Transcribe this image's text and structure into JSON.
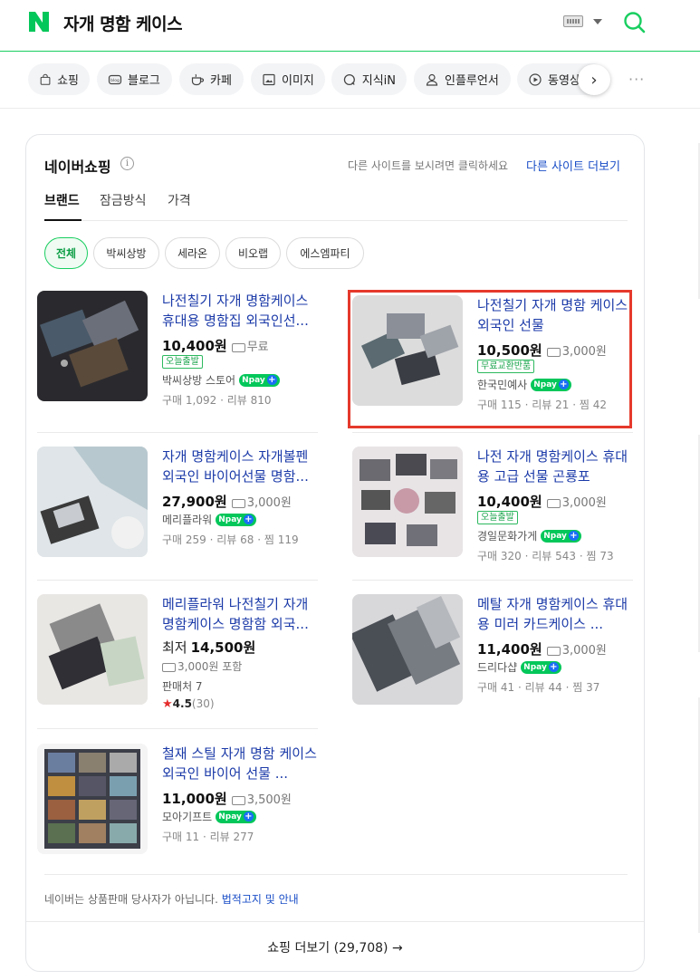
{
  "header": {
    "query": "자개 명함 케이스",
    "logo": "N"
  },
  "tabs": [
    {
      "label": "쇼핑",
      "icon": "shopping-bag-icon"
    },
    {
      "label": "블로그",
      "icon": "blog-icon"
    },
    {
      "label": "카페",
      "icon": "cafe-icon"
    },
    {
      "label": "이미지",
      "icon": "image-icon"
    },
    {
      "label": "지식iN",
      "icon": "kin-icon"
    },
    {
      "label": "인플루언서",
      "icon": "person-icon"
    },
    {
      "label": "동영상",
      "icon": "play-icon"
    }
  ],
  "card": {
    "title": "네이버쇼핑",
    "other_hint": "다른 사이트를 보시려면 클릭하세요",
    "other_link": "다른 사이트 더보기",
    "filter_tabs": [
      "브랜드",
      "잠금방식",
      "가격"
    ],
    "chips": [
      "전체",
      "박씨상방",
      "세라온",
      "비오랩",
      "에스엠파티"
    ],
    "disclaimer": "네이버는 상품판매 당사자가 아닙니다.",
    "disclaimer_link": "법적고지 및 안내",
    "more_button": "쇼핑 더보기 (29,708) →"
  },
  "products": [
    {
      "title": "나전칠기 자개 명함케이스 휴대용 명함집 외국인선...",
      "price": "10,400원",
      "shipping": "무료",
      "badge": "오늘출발",
      "seller": "박씨상방 스토어",
      "npay": true,
      "stats": "구매 1,092 · 리뷰 810"
    },
    {
      "title": "나전칠기 자개 명함 케이스 외국인 선물",
      "price": "10,500원",
      "shipping": "3,000원",
      "badge": "무료교환반품",
      "seller": "한국민예사",
      "npay": true,
      "stats": "구매 115 · 리뷰 21 · 찜 42"
    },
    {
      "title": "자개 명함케이스 자개볼펜 외국인 바이어선물 명함...",
      "price": "27,900원",
      "shipping": "3,000원",
      "seller": "메리플라워",
      "npay": true,
      "stats": "구매 259 · 리뷰 68 · 찜 119"
    },
    {
      "title": "나전 자개 명함케이스 휴대용 고급 선물 곤룡포",
      "price": "10,400원",
      "shipping": "3,000원",
      "badge": "오늘출발",
      "seller": "경일문화가게",
      "npay": true,
      "stats": "구매 320 · 리뷰 543 · 찜 73"
    },
    {
      "title": "메리플라워 나전칠기 자개 명함케이스 명함함 외국...",
      "price_prefix": "최저",
      "price": "14,500원",
      "shipping": "3,000원 포함",
      "seller": "판매처 7",
      "rating": "4.5",
      "rating_count": "(30)"
    },
    {
      "title": "메탈 자개 명함케이스 휴대용 미러 카드케이스 ...",
      "price": "11,400원",
      "shipping": "3,000원",
      "seller": "드리다샵",
      "npay": true,
      "stats": "구매 41 · 리뷰 44 · 찜 37"
    },
    {
      "title": "철재 스틸 자개 명함 케이스 외국인 바이어 선물 ...",
      "price": "11,000원",
      "shipping": "3,500원",
      "seller": "모아기프트",
      "npay": true,
      "stats": "구매 11 · 리뷰 277"
    }
  ],
  "npay_label": "pay",
  "npay_plus": "+",
  "more_dots": "···",
  "next_arrow": "›",
  "info_glyph": "i",
  "colors": {
    "brand_green": "#03c75a",
    "link_blue": "#1b3aa8",
    "highlight_red": "#e5392c"
  }
}
